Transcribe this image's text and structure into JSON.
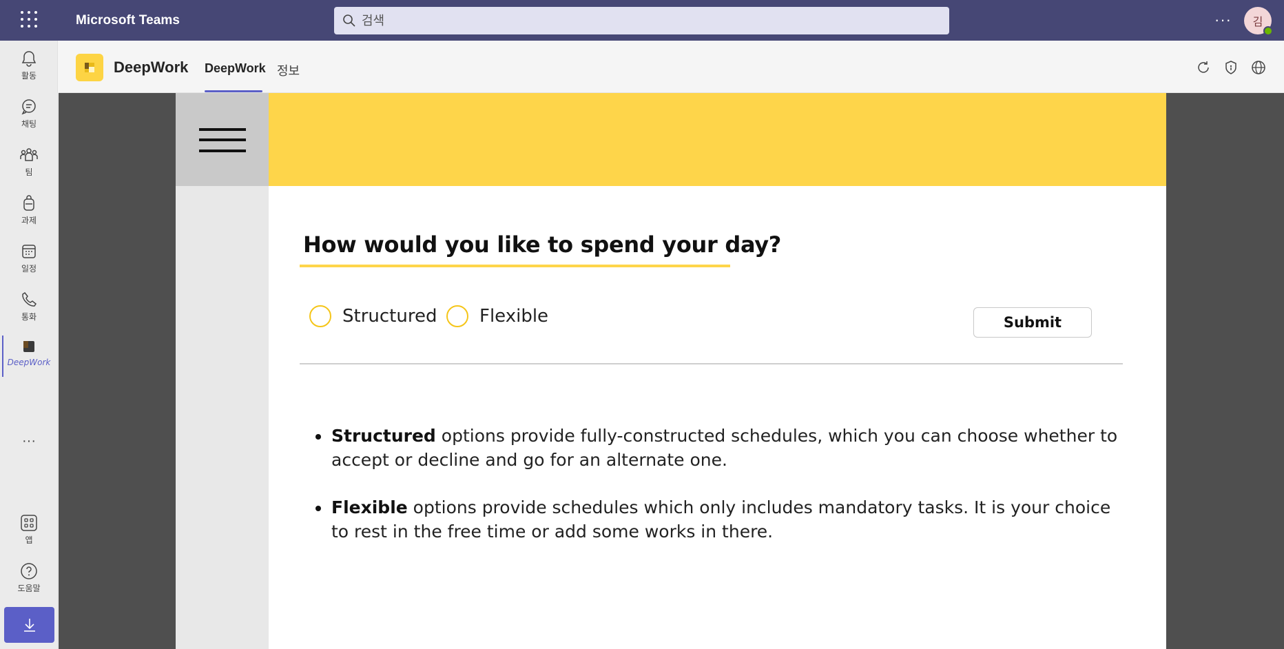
{
  "top_bar": {
    "app_title": "Microsoft Teams",
    "search_placeholder": "검색",
    "more_label": "···",
    "avatar_initial": "김"
  },
  "rail": {
    "items": [
      {
        "label": "활동",
        "icon": "bell-icon"
      },
      {
        "label": "채팅",
        "icon": "chat-icon"
      },
      {
        "label": "팀",
        "icon": "teams-icon"
      },
      {
        "label": "과제",
        "icon": "backpack-icon"
      },
      {
        "label": "일정",
        "icon": "calendar-icon"
      },
      {
        "label": "통화",
        "icon": "phone-icon"
      },
      {
        "label": "DeepWork",
        "icon": "deepwork-app-icon",
        "active": true
      }
    ],
    "more_label": "···",
    "bottom_items": [
      {
        "label": "앱",
        "icon": "apps-icon"
      },
      {
        "label": "도움말",
        "icon": "help-icon"
      }
    ]
  },
  "app_header": {
    "app_name": "DeepWork",
    "tabs": [
      {
        "label": "DeepWork",
        "active": true
      },
      {
        "label": "정보",
        "active": false
      }
    ]
  },
  "main": {
    "question": "How would you like to spend your day?",
    "options": [
      "Structured",
      "Flexible"
    ],
    "submit_label": "Submit",
    "bullets": [
      {
        "bold": "Structured",
        "text": " options provide fully-constructed schedules, which you can choose whether to accept or decline and go for an alternate one."
      },
      {
        "bold": "Flexible",
        "text": " options provide schedules which only includes mandatory tasks. It is your choice to rest in the free time or add some works in there."
      }
    ]
  },
  "colors": {
    "teams_purple": "#464775",
    "accent": "#5b5fc7",
    "banner_yellow": "#fed54a"
  }
}
